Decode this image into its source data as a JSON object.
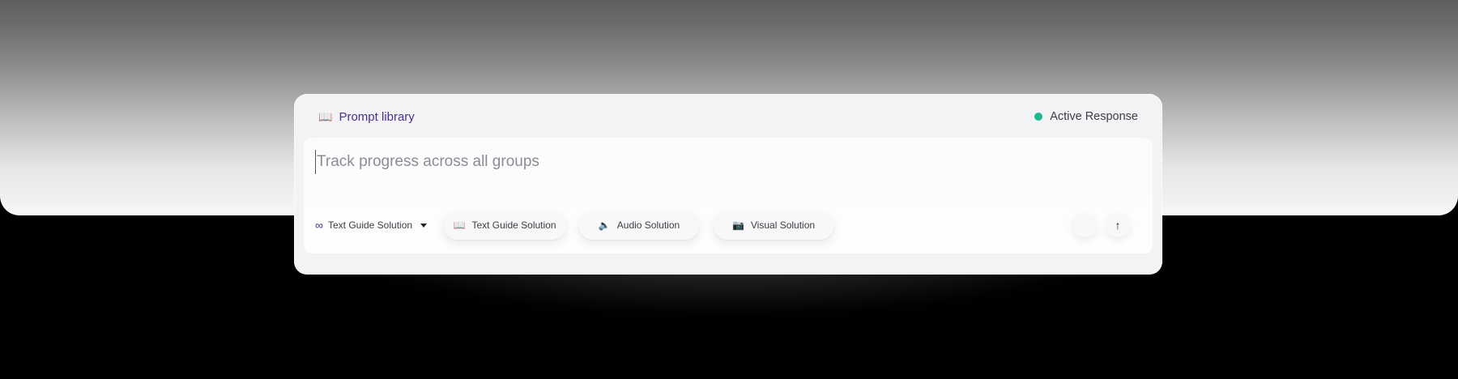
{
  "header": {
    "prompt_library_label": "Prompt library",
    "prompt_library_icon": "book-icon",
    "status_label": "Active Response",
    "status_color": "#1fb78f"
  },
  "input": {
    "placeholder": "Track progress across all groups",
    "value": ""
  },
  "toolbar": {
    "mode_selector": {
      "icon": "infinity-icon",
      "label": "Text Guide Solution"
    },
    "chips": [
      {
        "icon": "book-icon",
        "label": "Text Guide Solution"
      },
      {
        "icon": "speaker-icon",
        "label": "Audio Solution"
      },
      {
        "icon": "camera-icon",
        "label": "Visual Solution"
      }
    ],
    "voice_button_icon": "waveform-icon",
    "send_button_icon": "arrow-up-icon"
  },
  "colors": {
    "accent": "#4a2f8f",
    "waveform_gradient": [
      "#7b6cf0",
      "#b39af5"
    ]
  }
}
